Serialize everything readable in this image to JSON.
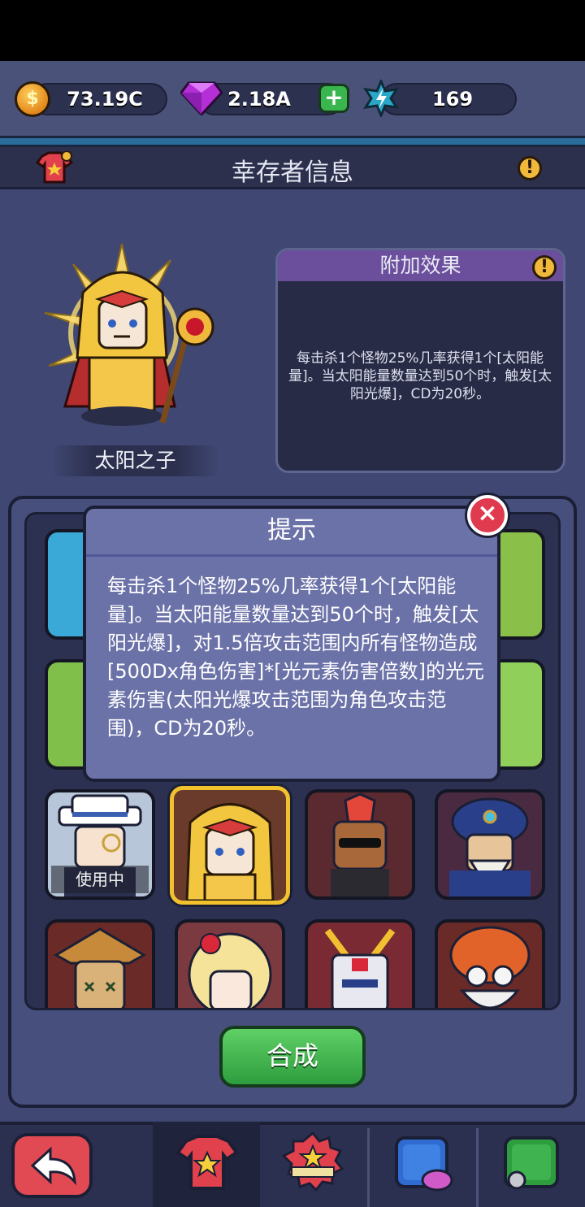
{
  "currency": {
    "gold_icon_symbol": "$",
    "gold_value": "73.19C",
    "gem_value": "2.18A",
    "add_gems_label": "+",
    "energy_value": "169"
  },
  "header": {
    "title": "幸存者信息",
    "info_label": "!"
  },
  "hero": {
    "name": "太阳之子"
  },
  "effect_panel": {
    "title": "附加效果",
    "info_label": "!",
    "description": "每击杀1个怪物25%几率获得1个[太阳能量]。当太阳能量数量达到50个时，触发[太阳光爆]，CD为20秒。"
  },
  "grid": {
    "cards": [
      {
        "label": ""
      },
      {
        "label": ""
      },
      {
        "label": ""
      },
      {
        "label": ""
      },
      {
        "label": ""
      },
      {
        "label": ""
      },
      {
        "label": ""
      },
      {
        "label": ""
      },
      {
        "label": "使用中"
      },
      {
        "label": ""
      },
      {
        "label": ""
      },
      {
        "label": ""
      },
      {
        "label": ""
      },
      {
        "label": ""
      },
      {
        "label": ""
      },
      {
        "label": ""
      }
    ],
    "craft_label": "合成"
  },
  "dialog": {
    "title": "提示",
    "text": "每击杀1个怪物25%几率获得1个[太阳能量]。当太阳能量数量达到50个时，触发[太阳光爆]，对1.5倍攻击范围内所有怪物造成[500Dx角色伤害]*[光元素伤害倍数]的光元素伤害(太阳光爆攻击范围为角色攻击范围)，CD为20秒。",
    "close_label": "×"
  },
  "colors": {
    "accent_gold": "#f2c12e",
    "craft_green": "#3fb34f",
    "close_red": "#e03a4e",
    "effect_header_purple": "#6b4f9c"
  },
  "icons": {
    "back": "back-arrow-icon",
    "shirt": "shirt-icon",
    "badge": "rank-badge-icon",
    "pet": "pet-icon",
    "skin": "skin-icon"
  }
}
